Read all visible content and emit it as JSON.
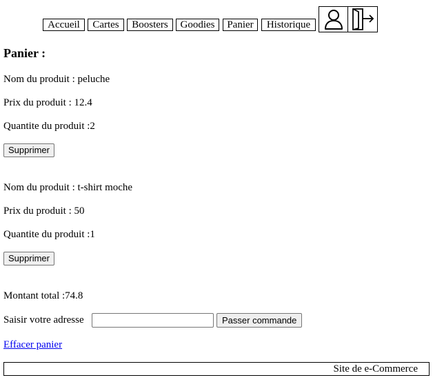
{
  "nav": {
    "items": [
      {
        "label": "Accueil"
      },
      {
        "label": "Cartes"
      },
      {
        "label": "Boosters"
      },
      {
        "label": "Goodies"
      },
      {
        "label": "Panier"
      },
      {
        "label": "Historique"
      }
    ],
    "icons": [
      {
        "name": "user-icon"
      },
      {
        "name": "logout-door-icon"
      }
    ]
  },
  "cart": {
    "title": "Panier :",
    "products": [
      {
        "name_line": "Nom du produit : peluche",
        "price_line": "Prix du produit : 12.4",
        "qty_line": "Quantite du produit :2",
        "delete_label": "Supprimer"
      },
      {
        "name_line": "Nom du produit : t-shirt moche",
        "price_line": "Prix du produit : 50",
        "qty_line": "Quantite du produit :1",
        "delete_label": "Supprimer"
      }
    ],
    "total_line": "Montant total :74.8",
    "address_label": "Saisir votre adresse",
    "address_value": "",
    "order_label": "Passer commande",
    "clear_label": "Effacer panier"
  },
  "footer": {
    "text": "Site de e-Commerce"
  }
}
